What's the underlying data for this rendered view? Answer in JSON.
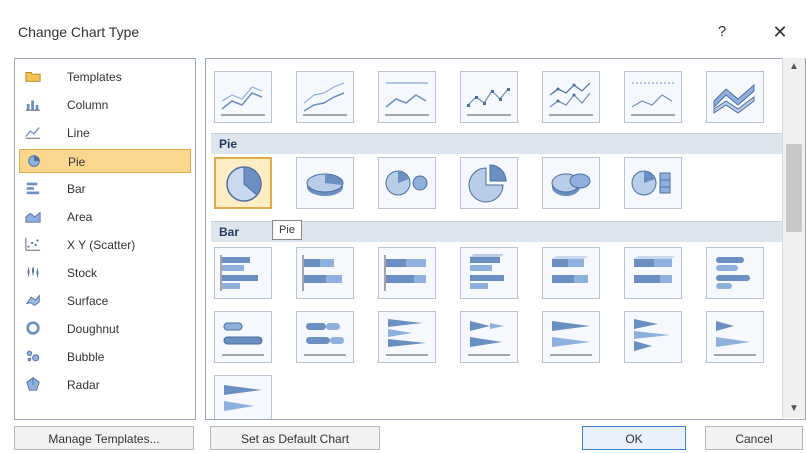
{
  "dialog": {
    "title": "Change Chart Type",
    "help_glyph": "?",
    "close_glyph": "✕"
  },
  "categories": [
    {
      "label": "Templates",
      "icon": "folder-icon"
    },
    {
      "label": "Column",
      "icon": "column-chart-icon"
    },
    {
      "label": "Line",
      "icon": "line-chart-icon"
    },
    {
      "label": "Pie",
      "icon": "pie-chart-icon",
      "selected": true
    },
    {
      "label": "Bar",
      "icon": "bar-chart-icon"
    },
    {
      "label": "Area",
      "icon": "area-chart-icon"
    },
    {
      "label": "X Y (Scatter)",
      "icon": "scatter-chart-icon"
    },
    {
      "label": "Stock",
      "icon": "stock-chart-icon"
    },
    {
      "label": "Surface",
      "icon": "surface-chart-icon"
    },
    {
      "label": "Doughnut",
      "icon": "doughnut-chart-icon"
    },
    {
      "label": "Bubble",
      "icon": "bubble-chart-icon"
    },
    {
      "label": "Radar",
      "icon": "radar-chart-icon"
    }
  ],
  "sections": {
    "pie": "Pie",
    "bar": "Bar"
  },
  "tooltip": "Pie",
  "buttons": {
    "manage_templates": "Manage Templates...",
    "set_default": "Set as Default Chart",
    "ok": "OK",
    "cancel": "Cancel"
  },
  "colors": {
    "selection": "#f9d78f",
    "section_header": "#dde5ef",
    "border": "#9aa7b8"
  }
}
